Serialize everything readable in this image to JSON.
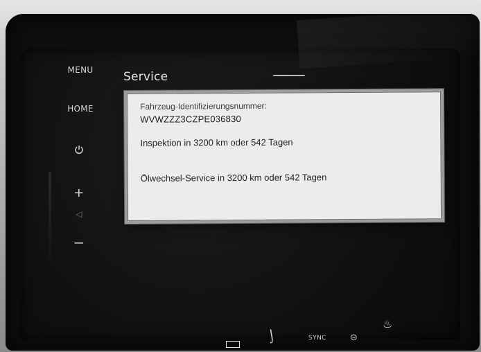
{
  "side_buttons": {
    "menu_label": "MENU",
    "home_label": "HOME",
    "power_icon": "power-icon",
    "plus_label": "+",
    "minus_label": "−"
  },
  "header": {
    "title": "Service"
  },
  "dialog": {
    "vin_label": "Fahrzeug-Identifizierungsnummer:",
    "vin_value": "WVWZZZ3CZPE036830",
    "inspection_text": "Inspektion in 3200 km oder 542 Tagen",
    "oil_service_text": "Ölwechsel-Service in 3200 km oder 542 Tagen"
  },
  "bottom_bar": {
    "sync_label": "SYNC"
  },
  "icons": {
    "back": "back-arrow-icon",
    "seat": "seat-icon",
    "recirculation": "recirculation-icon",
    "heated_steering": "heated-steering-icon"
  },
  "colors": {
    "screen_bg": "#111112",
    "dialog_bg": "#ececec",
    "text_light": "#e6e6e6",
    "back_border": "#9ea6bd"
  }
}
